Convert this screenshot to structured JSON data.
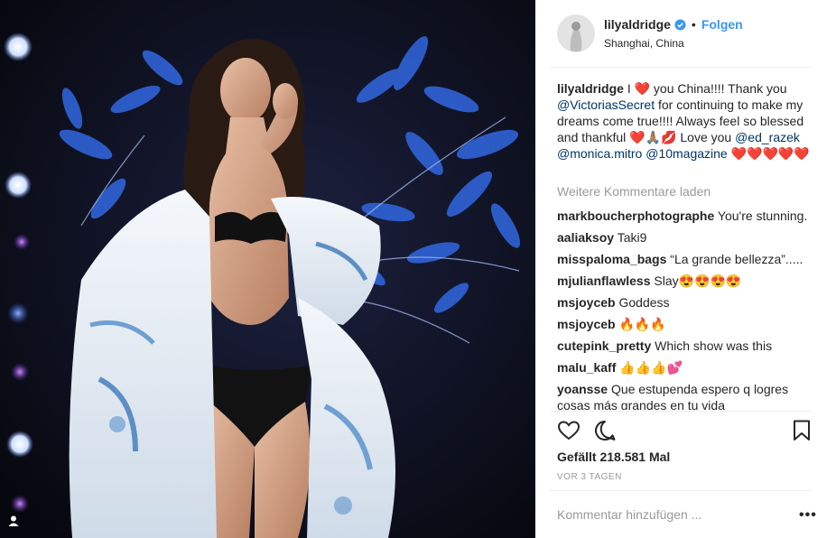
{
  "header": {
    "username": "lilyaldridge",
    "separator": "•",
    "follow_label": "Folgen",
    "location": "Shanghai, China"
  },
  "caption": {
    "username": "lilyaldridge",
    "part1": "I",
    "part2": "you China!!!! Thank you",
    "mention1": "@VictoriasSecret",
    "part3": "for continuing to make my dreams come true!!!! Always feel so blessed and thankful",
    "part4": "Love you",
    "mention2": "@ed_razek",
    "mention3": "@monica.mitro",
    "mention4": "@10magazine"
  },
  "load_more_label": "Weitere Kommentare laden",
  "comments": [
    {
      "user": "markboucherphotographe",
      "text": "You're stunning."
    },
    {
      "user": "aaliaksoy",
      "text": "Taki9"
    },
    {
      "user": "misspaloma_bags",
      "text": "“La grande bellezza”....."
    },
    {
      "user": "mjulianflawless",
      "text": "Slay😍😍😍😍"
    },
    {
      "user": "msjoyceb",
      "text": "Goddess"
    },
    {
      "user": "msjoyceb",
      "text": "🔥🔥🔥"
    },
    {
      "user": "cutepink_pretty",
      "text": "Which show was this"
    },
    {
      "user": "malu_kaff",
      "text": "👍👍👍💕"
    },
    {
      "user": "yoansse",
      "text": "Que estupenda espero q logres cosas más grandes en tu vida"
    }
  ],
  "likes_label": "Gefällt 218.581 Mal",
  "date_label": "VOR 3 TAGEN",
  "comment_placeholder": "Kommentar hinzufügen ...",
  "more_label": "•••",
  "icons": {
    "like": "heart-icon",
    "comment": "comment-icon",
    "save": "bookmark-icon",
    "verified": "verified-badge-icon",
    "user_tag": "user-tag-icon",
    "more": "more-options-icon"
  },
  "colors": {
    "link": "#3897f0",
    "mention": "#003569",
    "muted": "#999999",
    "heart": "#ed4956"
  }
}
